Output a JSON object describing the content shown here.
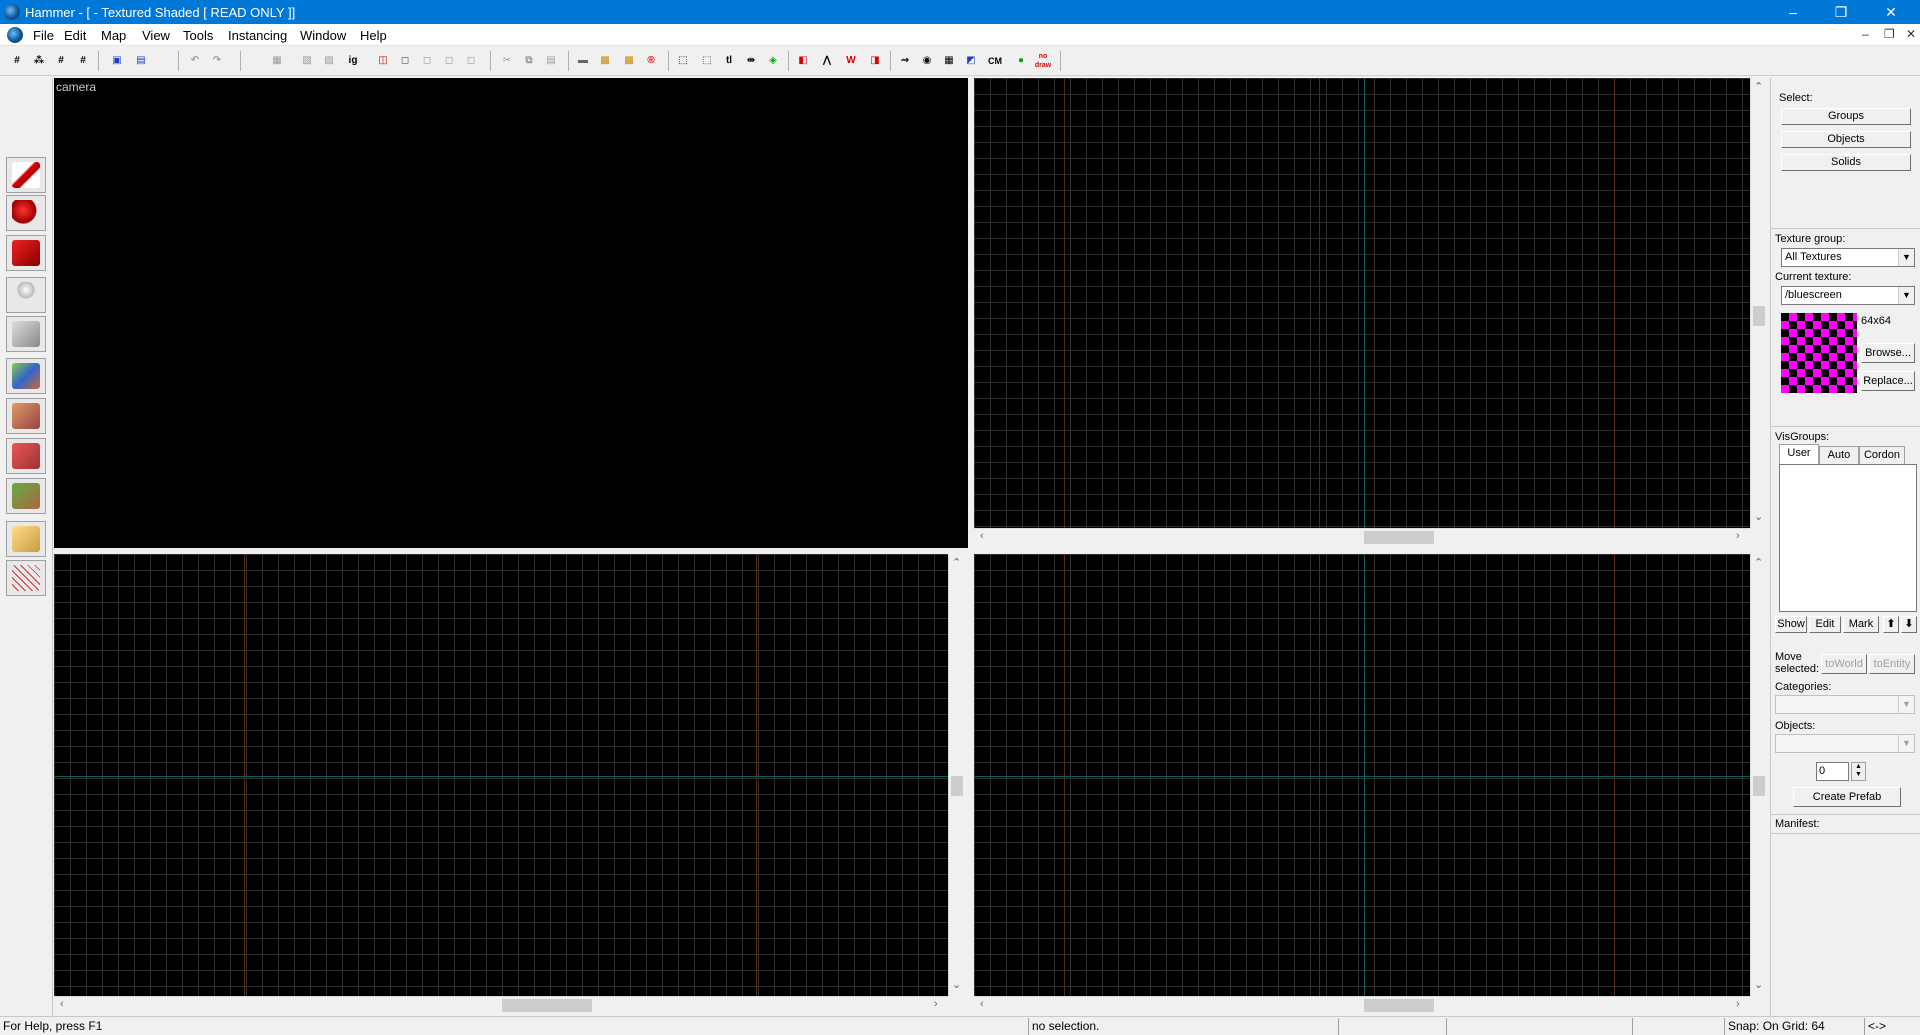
{
  "window": {
    "title": "Hammer - [ - Textured Shaded [ READ ONLY ]]",
    "minimize": "–",
    "restore": "❐",
    "close": "✕"
  },
  "menu": {
    "items": [
      "File",
      "Edit",
      "Map",
      "View",
      "Tools",
      "Instancing",
      "Window",
      "Help"
    ],
    "mdi_min": "–",
    "mdi_restore": "❐",
    "mdi_close": "✕"
  },
  "toolbar": {
    "cordon_label": "CM",
    "nodraw_label": "no draw"
  },
  "views": {
    "camera_label": "camera"
  },
  "right_panel": {
    "select_label": "Select:",
    "groups": "Groups",
    "objects": "Objects",
    "solids": "Solids",
    "texture_group_label": "Texture group:",
    "texture_group_value": "All Textures",
    "current_texture_label": "Current texture:",
    "current_texture_value": "/bluescreen",
    "texture_size": "64x64",
    "browse": "Browse...",
    "replace": "Replace...",
    "visgroups_label": "VisGroups:",
    "tabs": [
      "User",
      "Auto",
      "Cordon"
    ],
    "show": "Show",
    "edit": "Edit",
    "mark": "Mark",
    "move_selected": "Move selected:",
    "to_world": "toWorld",
    "to_entity": "toEntity",
    "categories_label": "Categories:",
    "objects_label": "Objects:",
    "spin_value": "0",
    "create_prefab": "Create Prefab",
    "manifest_label": "Manifest:"
  },
  "status": {
    "help": "For Help, press F1",
    "selection": "no selection.",
    "snap": "Snap: On Grid: 64",
    "arrows": "<->"
  },
  "colors": {
    "titlebar": "#0078d7",
    "viewport": "#000000",
    "grid_axis": "#0e5f5f",
    "texture_magenta": "#ff00ff"
  }
}
